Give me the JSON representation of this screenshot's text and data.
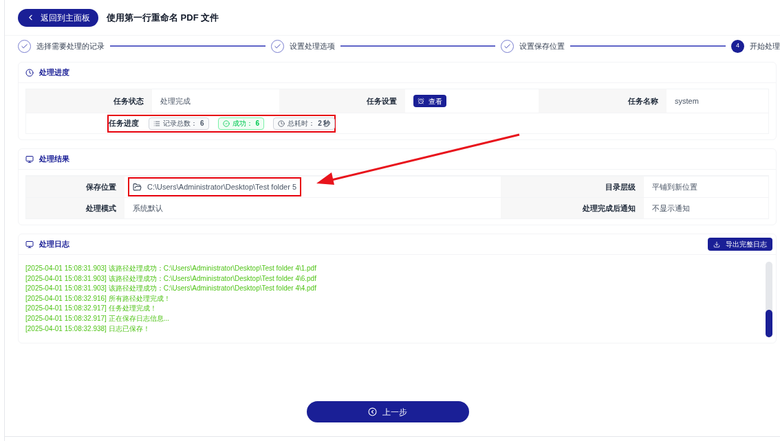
{
  "header": {
    "back_button": "返回到主面板",
    "title": "使用第一行重命名 PDF 文件"
  },
  "steps": [
    {
      "label": "选择需要处理的记录",
      "done": true
    },
    {
      "label": "设置处理选项",
      "done": true
    },
    {
      "label": "设置保存位置",
      "done": true
    },
    {
      "label": "开始处理",
      "number": "4",
      "done": false
    }
  ],
  "progress": {
    "title": "处理进度",
    "status_label": "任务状态",
    "status_value": "处理完成",
    "settings_label": "任务设置",
    "settings_button": "查看",
    "name_label": "任务名称",
    "name_value": "system",
    "progress_label": "任务进度",
    "chips": [
      {
        "kind": "total",
        "label": "记录总数：",
        "value": "6"
      },
      {
        "kind": "success",
        "label": "成功：",
        "value": "6"
      },
      {
        "kind": "time",
        "label": "总耗时：",
        "value": "2 秒"
      }
    ]
  },
  "result": {
    "title": "处理结果",
    "rows": [
      {
        "label": "保存位置",
        "value": "C:\\Users\\Administrator\\Desktop\\Test folder 5",
        "label_2": "目录层级",
        "value_2": "平铺到新位置"
      },
      {
        "label": "处理模式",
        "value": "系统默认",
        "label_2": "处理完成后通知",
        "value_2": "不显示通知"
      }
    ]
  },
  "log": {
    "title": "处理日志",
    "export_button": "导出完整日志",
    "lines": [
      "[2025-04-01 15:08:31.903] 该路径处理成功：C:\\Users\\Administrator\\Desktop\\Test folder 4\\1.pdf",
      "[2025-04-01 15:08:31.903] 该路径处理成功：C:\\Users\\Administrator\\Desktop\\Test folder 4\\6.pdf",
      "[2025-04-01 15:08:31.903] 该路径处理成功：C:\\Users\\Administrator\\Desktop\\Test folder 4\\4.pdf",
      "[2025-04-01 15:08:32.916] 所有路径处理完成！",
      "[2025-04-01 15:08:32.917] 任务处理完成！",
      "[2025-04-01 15:08:32.917] 正在保存日志信息...",
      "[2025-04-01 15:08:32.938] 日志已保存！"
    ]
  },
  "footer": {
    "prev_button": "上一步"
  }
}
